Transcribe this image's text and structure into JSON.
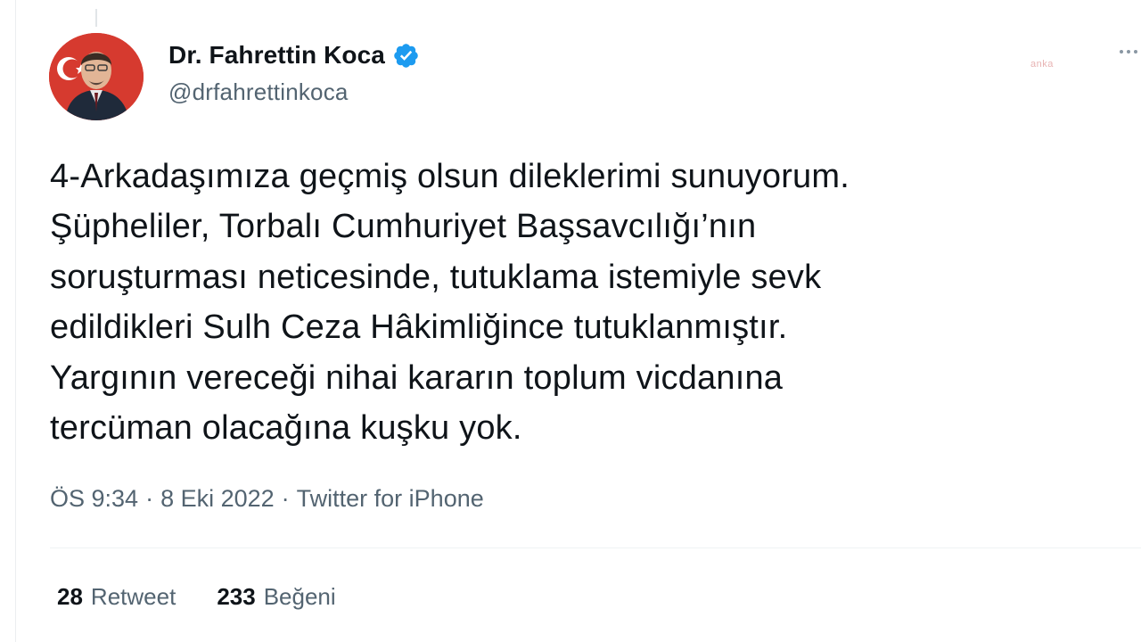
{
  "tweet": {
    "author": {
      "display_name": "Dr. Fahrettin Koca",
      "handle": "@drfahrettinkoca",
      "verified": true
    },
    "text": "4-Arkadaşımıza geçmiş olsun dileklerimi sunuyorum.\nŞüpheliler, Torbalı Cumhuriyet Başsavcılığı’nın\nsoruşturması neticesinde, tutuklama istemiyle sevk\nedildikleri Sulh Ceza Hâkimliğince tutuklanmıştır.\nYargının vereceği nihai kararın toplum vicdanına\ntercüman olacağına kuşku yok.",
    "meta": {
      "time": "ÖS 9:34",
      "separator": "·",
      "date": "8 Eki 2022",
      "source": "Twitter for iPhone"
    },
    "stats": {
      "retweets": {
        "count": "28",
        "label": "Retweet"
      },
      "likes": {
        "count": "233",
        "label": "Beğeni"
      }
    }
  },
  "watermark": "anka",
  "colors": {
    "text": "#0f1419",
    "secondary": "#536471",
    "verified": "#1d9bf0",
    "divider": "#eff3f4"
  },
  "icons": {
    "verified": "verified-badge-icon",
    "more": "more-options-icon"
  }
}
